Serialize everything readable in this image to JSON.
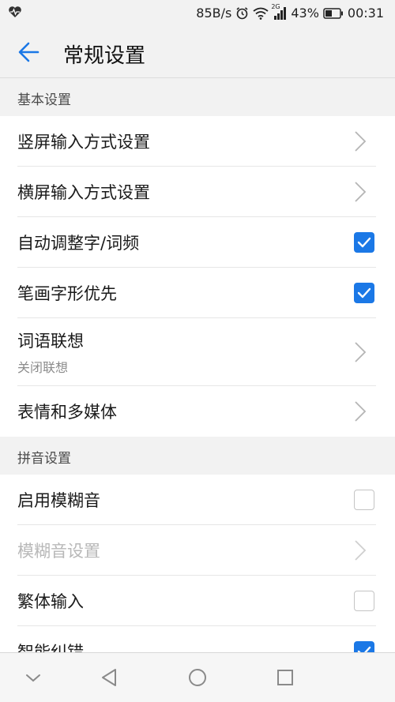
{
  "status_bar": {
    "left_icon": "health-heart-icon",
    "speed": "85B/s",
    "battery": "43%",
    "time": "00:31",
    "network": "2G"
  },
  "header": {
    "title": "常规设置",
    "back_icon": "back-arrow-icon"
  },
  "colors": {
    "accent": "#1b78e6",
    "background": "#f2f2f2"
  },
  "sections": [
    {
      "title": "基本设置",
      "items": [
        {
          "label": "竖屏输入方式设置",
          "control": "chevron"
        },
        {
          "label": "横屏输入方式设置",
          "control": "chevron"
        },
        {
          "label": "自动调整字/词频",
          "control": "checkbox",
          "checked": true
        },
        {
          "label": "笔画字形优先",
          "control": "checkbox",
          "checked": true
        },
        {
          "label": "词语联想",
          "sublabel": "关闭联想",
          "control": "chevron"
        },
        {
          "label": "表情和多媒体",
          "control": "chevron"
        }
      ]
    },
    {
      "title": "拼音设置",
      "items": [
        {
          "label": "启用模糊音",
          "control": "checkbox",
          "checked": false
        },
        {
          "label": "模糊音设置",
          "control": "chevron",
          "disabled": true
        },
        {
          "label": "繁体输入",
          "control": "checkbox",
          "checked": false
        },
        {
          "label": "智能纠错",
          "control": "checkbox",
          "checked": true
        }
      ]
    }
  ],
  "nav_bar": [
    "collapse-icon",
    "back-triangle-icon",
    "home-circle-icon",
    "recents-square-icon"
  ]
}
